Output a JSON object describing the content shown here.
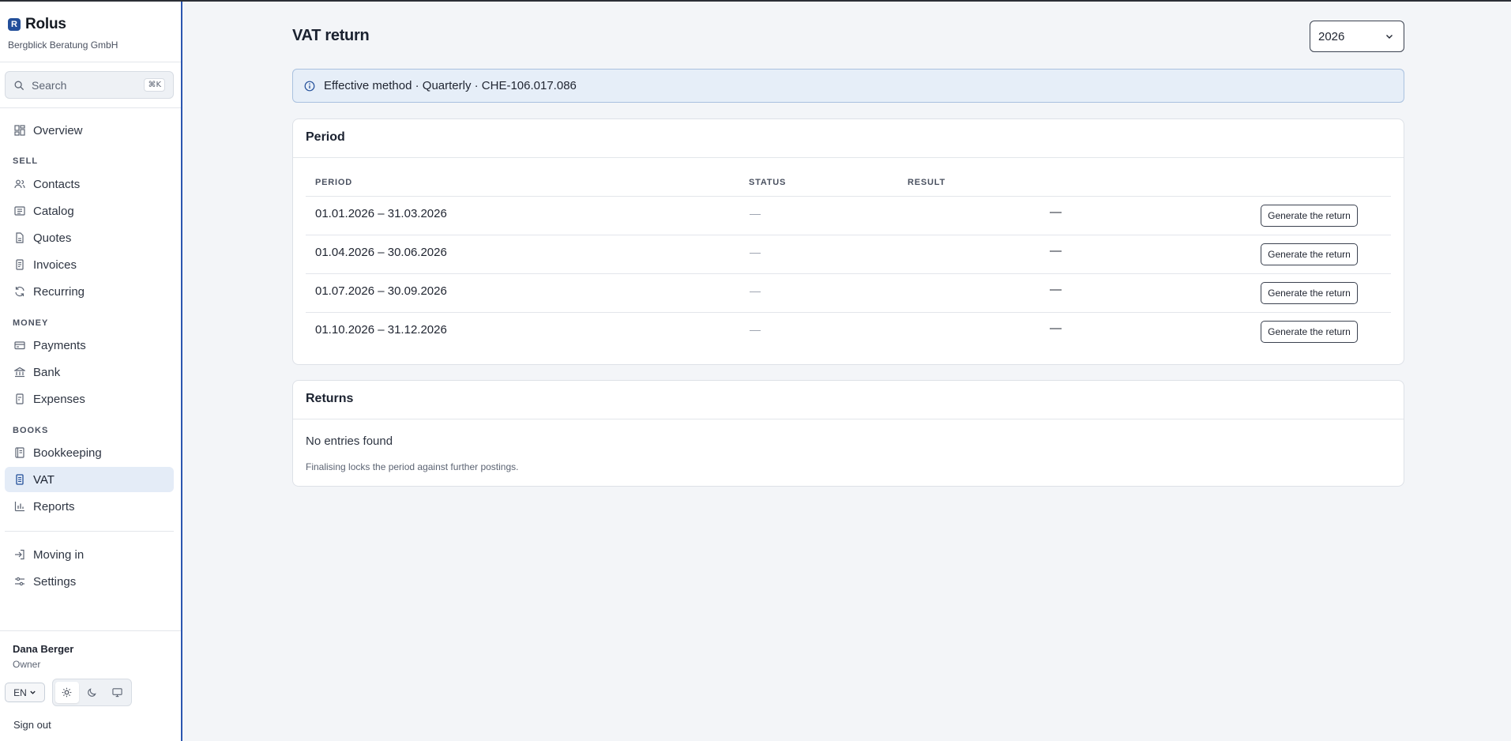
{
  "app": {
    "name": "Rolus",
    "logo_letter": "R",
    "company": "Bergblick Beratung GmbH"
  },
  "search": {
    "placeholder": "Search",
    "shortcut": "⌘K"
  },
  "sidebar": {
    "overview": {
      "label": "Overview",
      "icon": "layout-grid-icon"
    },
    "sections": {
      "sell": "SELL",
      "money": "MONEY",
      "books": "BOOKS"
    },
    "sell_items": [
      {
        "label": "Contacts",
        "icon": "users-icon"
      },
      {
        "label": "Catalog",
        "icon": "catalog-icon"
      },
      {
        "label": "Quotes",
        "icon": "quote-file-icon"
      },
      {
        "label": "Invoices",
        "icon": "invoice-file-icon"
      },
      {
        "label": "Recurring",
        "icon": "refresh-icon"
      }
    ],
    "money_items": [
      {
        "label": "Payments",
        "icon": "credit-card-icon"
      },
      {
        "label": "Bank",
        "icon": "bank-icon"
      },
      {
        "label": "Expenses",
        "icon": "receipt-icon"
      }
    ],
    "books_items": [
      {
        "label": "Bookkeeping",
        "icon": "ledger-icon"
      },
      {
        "label": "VAT",
        "icon": "vat-document-icon",
        "active": true
      },
      {
        "label": "Reports",
        "icon": "bar-chart-icon"
      }
    ],
    "footer_items": [
      {
        "label": "Moving in",
        "icon": "log-in-icon"
      },
      {
        "label": "Settings",
        "icon": "sliders-icon"
      }
    ]
  },
  "user": {
    "name": "Dana Berger",
    "role": "Owner",
    "language": "EN",
    "sign_out": "Sign out",
    "theme_options": [
      "sun-icon",
      "moon-icon",
      "monitor-icon"
    ],
    "theme_selected": "light"
  },
  "page": {
    "title": "VAT return",
    "year": "2026",
    "info": "Effective method · Quarterly · CHE-106.017.086"
  },
  "period_card": {
    "title": "Period",
    "columns": [
      "PERIOD",
      "STATUS",
      "RESULT"
    ],
    "rows": [
      {
        "period": "01.01.2026 – 31.03.2026",
        "status": "—",
        "result": "—",
        "action": "Generate the return"
      },
      {
        "period": "01.04.2026 – 30.06.2026",
        "status": "—",
        "result": "—",
        "action": "Generate the return"
      },
      {
        "period": "01.07.2026 – 30.09.2026",
        "status": "—",
        "result": "—",
        "action": "Generate the return"
      },
      {
        "period": "01.10.2026 – 31.12.2026",
        "status": "—",
        "result": "—",
        "action": "Generate the return"
      }
    ]
  },
  "returns_card": {
    "title": "Returns",
    "empty": "No entries found",
    "note": "Finalising locks the period against further postings."
  },
  "colors": {
    "accent": "#234f9a",
    "active_nav_bg": "#e4ecf7",
    "banner_bg": "#e6eef8",
    "banner_border": "#a9c1df"
  }
}
